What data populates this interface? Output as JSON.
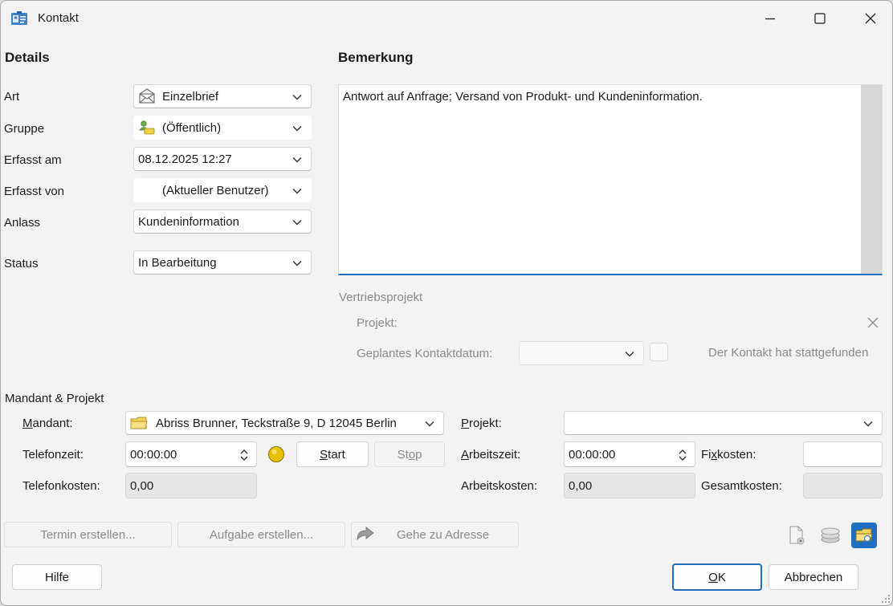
{
  "window": {
    "title": "Kontakt",
    "app_icon": "contact-card-icon",
    "controls": [
      "minimize-icon",
      "maximize-icon",
      "close-icon"
    ]
  },
  "details": {
    "heading": "Details",
    "rows": [
      {
        "label": "Art",
        "value": "Einzelbrief",
        "icon": "envelope-icon"
      },
      {
        "label": "Gruppe",
        "value": "(Öffentlich)",
        "icon": "group-icon"
      },
      {
        "label": "Erfasst am",
        "value": "08.12.2025 12:27"
      },
      {
        "label": "Erfasst von",
        "value": "(Aktueller Benutzer)"
      },
      {
        "label": "Anlass",
        "value": "Kundeninformation"
      },
      {
        "label": "Status",
        "value": "In Bearbeitung"
      }
    ]
  },
  "remark": {
    "heading": "Bemerkung",
    "text": "Antwort auf Anfrage; Versand von Produkt- und Kundeninformation."
  },
  "sales_project": {
    "heading": "Vertriebsprojekt",
    "project_label": "Projekt:",
    "planned_date_label": "Geplantes Kontaktdatum:",
    "planned_date_value": "",
    "took_place_label": "Der Kontakt hat stattgefunden"
  },
  "client_project": {
    "heading": "Mandant & Projekt",
    "mandant_label": "Mandant:",
    "mandant_value": "Abriss Brunner, Teckstraße 9, D 12045 Berlin",
    "projekt_label": "Projekt:",
    "projekt_value": "",
    "phone_time_label": "Telefonzeit:",
    "phone_time_value": "00:00:00",
    "start_label": "Start",
    "stop_label": "Stop",
    "work_time_label": "Arbeitszeit:",
    "work_time_value": "00:00:00",
    "fixed_costs_label": "Fixkosten:",
    "fixed_costs_value": "",
    "phone_costs_label": "Telefonkosten:",
    "phone_costs_value": "0,00",
    "work_costs_label": "Arbeitskosten:",
    "work_costs_value": "0,00",
    "total_costs_label": "Gesamtkosten:",
    "total_costs_value": ""
  },
  "actions": {
    "create_appointment": "Termin erstellen...",
    "create_task": "Aufgabe erstellen...",
    "goto_address": "Gehe zu Adresse"
  },
  "footer": {
    "help": "Hilfe",
    "ok": "OK",
    "cancel": "Abbrechen"
  },
  "colors": {
    "accent": "#1e6fc2",
    "status_light": "#e8c20a",
    "window_bg": "#f3f3f3"
  }
}
